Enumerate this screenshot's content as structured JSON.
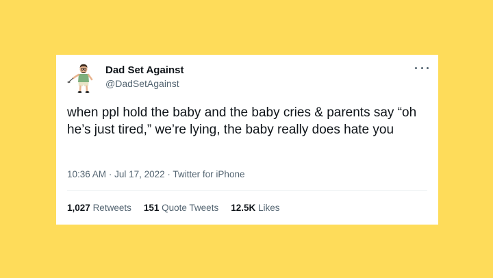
{
  "colors": {
    "background": "#fedc5a",
    "card": "#ffffff",
    "text_primary": "#0f1419",
    "text_secondary": "#536471"
  },
  "tweet": {
    "author": {
      "display_name": "Dad Set Against",
      "handle": "@DadSetAgainst",
      "avatar_icon": "cartoon-dad-avatar"
    },
    "more_icon": "more-options-icon",
    "text": "when ppl hold the baby and the baby cries & parents say “oh he’s just tired,” we’re lying, the baby really does hate you",
    "time": "10:36 AM",
    "date": "Jul 17, 2022",
    "source": "Twitter for iPhone",
    "separator": "·",
    "stats": {
      "retweets_count": "1,027",
      "retweets_label": "Retweets",
      "quote_tweets_count": "151",
      "quote_tweets_label": "Quote Tweets",
      "likes_count": "12.5K",
      "likes_label": "Likes"
    }
  }
}
